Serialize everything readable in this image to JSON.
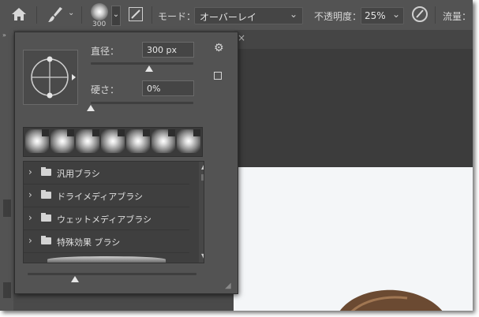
{
  "options_bar": {
    "brush_size": "300",
    "mode_label": "モード：",
    "mode_value": "オーバーレイ",
    "opacity_label": "不透明度：",
    "opacity_value": "25%",
    "flow_label": "流量："
  },
  "brush_panel": {
    "diameter_label": "直径：",
    "diameter_value": "300 px",
    "diameter_slider_pct": 57,
    "hardness_label": "硬さ：",
    "hardness_value": "0%",
    "hardness_slider_pct": 0,
    "folders": [
      {
        "label": "汎用ブラシ"
      },
      {
        "label": "ドライメディアブラシ"
      },
      {
        "label": "ウェットメディアブラシ"
      },
      {
        "label": "特殊効果 ブラシ"
      }
    ],
    "size_slider_pct": 28
  }
}
